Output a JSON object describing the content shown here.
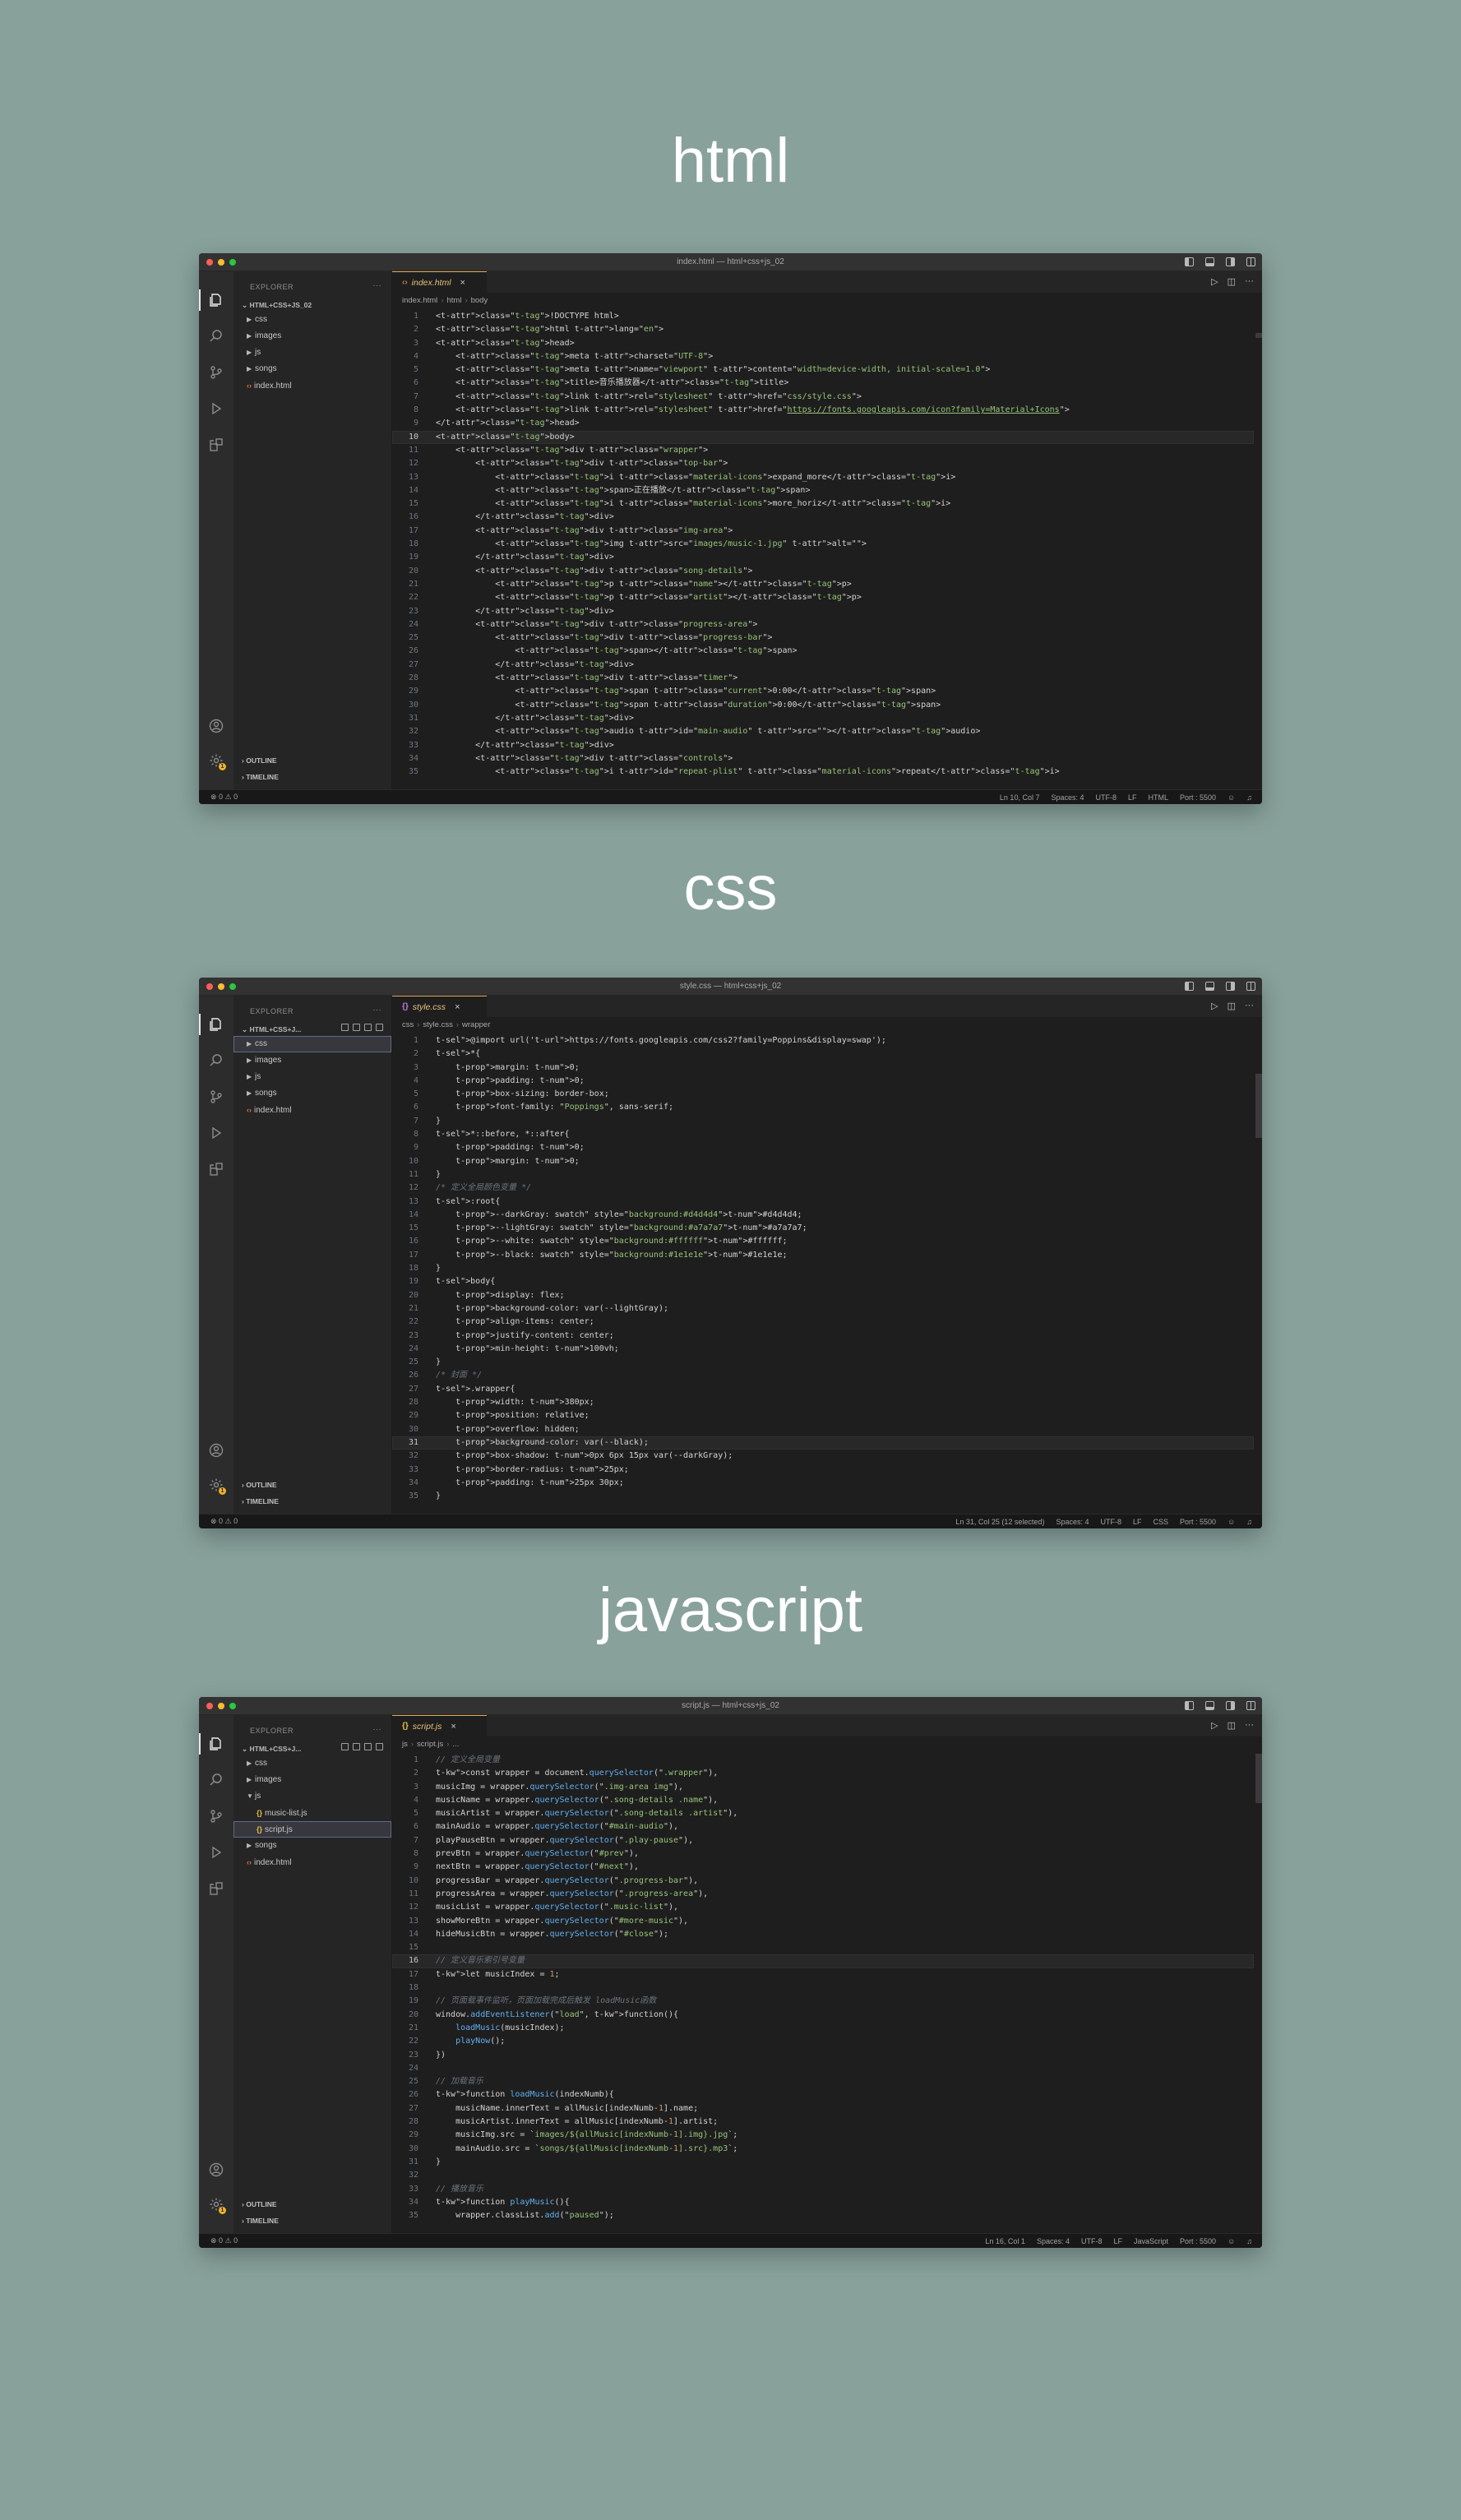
{
  "sections": [
    {
      "heading": "html",
      "window": {
        "title": "index.html — html+css+js_02",
        "tab": {
          "icon": "‹›",
          "icon_color": "#e37933",
          "label": "index.html"
        },
        "breadcrumb": [
          "index.html",
          "html",
          "body"
        ],
        "explorer": {
          "header": "EXPLORER",
          "root": "HTML+CSS+JS_02",
          "items": [
            {
              "label": "css",
              "type": "folder",
              "selected": false
            },
            {
              "label": "images",
              "type": "folder",
              "selected": false
            },
            {
              "label": "js",
              "type": "folder",
              "selected": false
            },
            {
              "label": "songs",
              "type": "folder",
              "selected": false
            },
            {
              "label": "index.html",
              "type": "html",
              "selected": false
            }
          ],
          "outline": "OUTLINE",
          "timeline": "TIMELINE"
        },
        "status": {
          "problems": "⊗ 0 ⚠ 0",
          "position": "Ln 10, Col 7",
          "spaces": "Spaces: 4",
          "encoding": "UTF-8",
          "eol": "LF",
          "language": "HTML",
          "port": "Port : 5500"
        },
        "highlight_line": 10,
        "lines": [
          "<!DOCTYPE html>",
          "<html lang=\"en\">",
          "<head>",
          "    <meta charset=\"UTF-8\">",
          "    <meta name=\"viewport\" content=\"width=device-width, initial-scale=1.0\">",
          "    <title>音乐播放器</title>",
          "    <link rel=\"stylesheet\" href=\"css/style.css\">",
          "    <link rel=\"stylesheet\" href=\"https://fonts.googleapis.com/icon?family=Material+Icons\">",
          "</head>",
          "<body>",
          "    <div class=\"wrapper\">",
          "        <div class=\"top-bar\">",
          "            <i class=\"material-icons\">expand_more</i>",
          "            <span>正在播放</span>",
          "            <i class=\"material-icons\">more_horiz</i>",
          "        </div>",
          "        <div class=\"img-area\">",
          "            <img src=\"images/music-1.jpg\" alt=\"\">",
          "        </div>",
          "        <div class=\"song-details\">",
          "            <p class=\"name\"></p>",
          "            <p class=\"artist\"></p>",
          "        </div>",
          "        <div class=\"progress-area\">",
          "            <div class=\"progress-bar\">",
          "                <span></span>",
          "            </div>",
          "            <div class=\"timer\">",
          "                <span class=\"current\">0:00</span>",
          "                <span class=\"duration\">0:00</span>",
          "            </div>",
          "            <audio id=\"main-audio\" src=\"\"></audio>",
          "        </div>",
          "        <div class=\"controls\">",
          "            <i id=\"repeat-plist\" class=\"material-icons\">repeat</i>"
        ]
      }
    },
    {
      "heading": "css",
      "window": {
        "title": "style.css — html+css+js_02",
        "tab": {
          "icon": "{}",
          "icon_color": "#c678dd",
          "label": "style.css"
        },
        "breadcrumb": [
          "css",
          "style.css",
          "wrapper"
        ],
        "explorer": {
          "header": "EXPLORER",
          "root": "HTML+CSS+J...",
          "items": [
            {
              "label": "css",
              "type": "folder",
              "selected": true
            },
            {
              "label": "images",
              "type": "folder",
              "selected": false
            },
            {
              "label": "js",
              "type": "folder",
              "selected": false
            },
            {
              "label": "songs",
              "type": "folder",
              "selected": false
            },
            {
              "label": "index.html",
              "type": "html",
              "selected": false
            }
          ],
          "outline": "OUTLINE",
          "timeline": "TIMELINE"
        },
        "status": {
          "problems": "⊗ 0 ⚠ 0",
          "position": "Ln 31, Col 25 (12 selected)",
          "spaces": "Spaces: 4",
          "encoding": "UTF-8",
          "eol": "LF",
          "language": "CSS",
          "port": "Port : 5500"
        },
        "highlight_line": 31,
        "lines": [
          "@import url('https://fonts.googleapis.com/css2?family=Poppins&display=swap');",
          "*{",
          "    margin: 0;",
          "    padding: 0;",
          "    box-sizing: border-box;",
          "    font-family: \"Poppings\", sans-serif;",
          "}",
          "*::before, *::after{",
          "    padding: 0;",
          "    margin: 0;",
          "}",
          "/* 定义全局颜色变量 */",
          ":root{",
          "    --darkGray: #d4d4d4;",
          "    --lightGray: #a7a7a7;",
          "    --white: #ffffff;",
          "    --black: #1e1e1e;",
          "}",
          "body{",
          "    display: flex;",
          "    background-color: var(--lightGray);",
          "    align-items: center;",
          "    justify-content: center;",
          "    min-height: 100vh;",
          "}",
          "/* 封面 */",
          ".wrapper{",
          "    width: 380px;",
          "    position: relative;",
          "    overflow: hidden;",
          "    background-color: var(--black);",
          "    box-shadow: 0px 6px 15px var(--darkGray);",
          "    border-radius: 25px;",
          "    padding: 25px 30px;",
          "}"
        ]
      }
    },
    {
      "heading": "javascript",
      "window": {
        "title": "script.js — html+css+js_02",
        "tab": {
          "icon": "{}",
          "icon_color": "#e2c046",
          "label": "script.js"
        },
        "breadcrumb": [
          "js",
          "script.js",
          "..."
        ],
        "explorer": {
          "header": "EXPLORER",
          "root": "HTML+CSS+J...",
          "items": [
            {
              "label": "css",
              "type": "folder",
              "selected": false
            },
            {
              "label": "images",
              "type": "folder",
              "selected": false
            },
            {
              "label": "js",
              "type": "folder-open",
              "selected": false
            },
            {
              "label": "music-list.js",
              "type": "js",
              "selected": false,
              "child": true
            },
            {
              "label": "script.js",
              "type": "js",
              "selected": true,
              "child": true
            },
            {
              "label": "songs",
              "type": "folder",
              "selected": false
            },
            {
              "label": "index.html",
              "type": "html",
              "selected": false
            }
          ],
          "outline": "OUTLINE",
          "timeline": "TIMELINE"
        },
        "status": {
          "problems": "⊗ 0 ⚠ 0",
          "position": "Ln 16, Col 1",
          "spaces": "Spaces: 4",
          "encoding": "UTF-8",
          "eol": "LF",
          "language": "JavaScript",
          "port": "Port : 5500"
        },
        "highlight_line": 16,
        "lines": [
          "// 定义全局变量",
          "const wrapper = document.querySelector(\".wrapper\"),",
          "musicImg = wrapper.querySelector(\".img-area img\"),",
          "musicName = wrapper.querySelector(\".song-details .name\"),",
          "musicArtist = wrapper.querySelector(\".song-details .artist\"),",
          "mainAudio = wrapper.querySelector(\"#main-audio\"),",
          "playPauseBtn = wrapper.querySelector(\".play-pause\"),",
          "prevBtn = wrapper.querySelector(\"#prev\"),",
          "nextBtn = wrapper.querySelector(\"#next\"),",
          "progressBar = wrapper.querySelector(\".progress-bar\"),",
          "progressArea = wrapper.querySelector(\".progress-area\"),",
          "musicList = wrapper.querySelector(\".music-list\"),",
          "showMoreBtn = wrapper.querySelector(\"#more-music\"),",
          "hideMusicBtn = wrapper.querySelector(\"#close\");",
          "",
          "// 定义音乐索引号变量",
          "let musicIndex = 1;",
          "",
          "// 页面载事件监听，页面加载完成后触发 loadMusic函数",
          "window.addEventListener(\"load\", function(){",
          "    loadMusic(musicIndex);",
          "    playNow();",
          "})",
          "",
          "// 加载音乐",
          "function loadMusic(indexNumb){",
          "    musicName.innerText = allMusic[indexNumb-1].name;",
          "    musicArtist.innerText = allMusic[indexNumb-1].artist;",
          "    musicImg.src = `images/${allMusic[indexNumb-1].img}.jpg`;",
          "    mainAudio.src = `songs/${allMusic[indexNumb-1].src}.mp3`;",
          "}",
          "",
          "// 播放音乐",
          "function playMusic(){",
          "    wrapper.classList.add(\"paused\");"
        ]
      }
    }
  ]
}
